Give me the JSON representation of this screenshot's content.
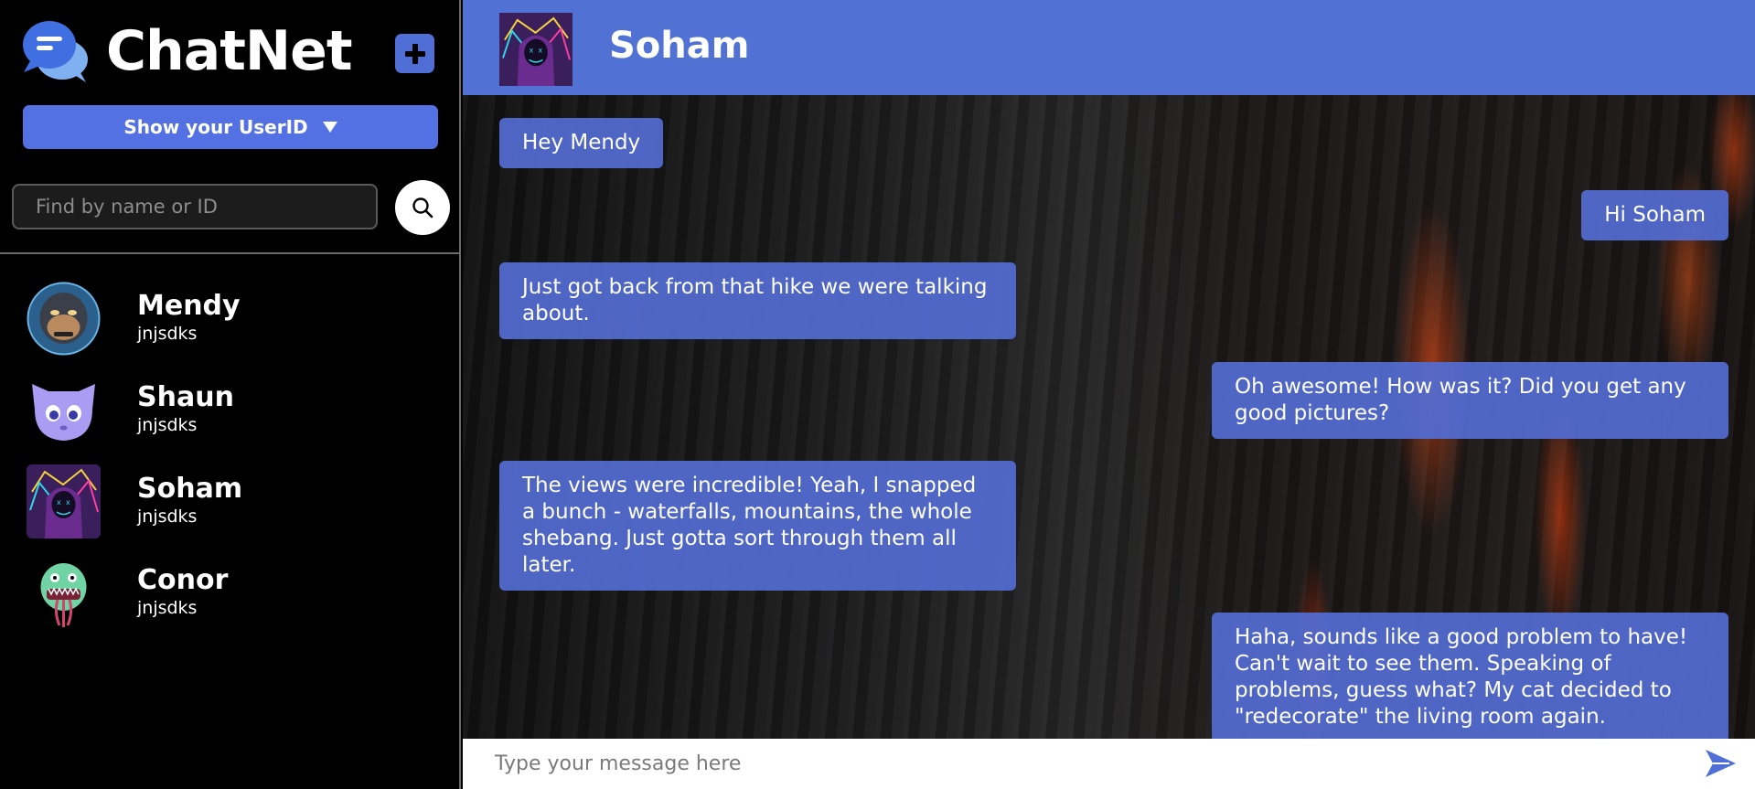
{
  "brand": {
    "title": "ChatNet"
  },
  "sidebar": {
    "userid_button": "Show your UserID",
    "search": {
      "placeholder": "Find by name or ID",
      "value": ""
    },
    "contacts": [
      {
        "name": "Mendy",
        "uid": "jnjsdks",
        "avatar": "gorilla-avatar"
      },
      {
        "name": "Shaun",
        "uid": "jnjsdks",
        "avatar": "purple-cat-avatar"
      },
      {
        "name": "Soham",
        "uid": "jnjsdks",
        "avatar": "hooded-figure-avatar"
      },
      {
        "name": "Conor",
        "uid": "jnjsdks",
        "avatar": "green-monster-avatar"
      }
    ]
  },
  "chat": {
    "title": "Soham",
    "messages": [
      {
        "dir": "in",
        "text": "Hey Mendy"
      },
      {
        "dir": "out",
        "text": "Hi Soham"
      },
      {
        "dir": "in",
        "text": "Just got back from that hike we were talking about."
      },
      {
        "dir": "out",
        "text": "Oh awesome! How was it? Did you get any good pictures?"
      },
      {
        "dir": "in",
        "text": "The views were incredible! Yeah, I snapped a bunch - waterfalls, mountains, the whole shebang. Just gotta sort through them all later."
      },
      {
        "dir": "out",
        "text": "Haha, sounds like a good problem to have! Can't wait to see them. Speaking of problems, guess what? My cat decided to \"redecorate\" the living room again."
      }
    ],
    "composer": {
      "placeholder": "Type your message here",
      "value": ""
    }
  },
  "colors": {
    "accent": "#5471e3",
    "header": "#5271d4",
    "bubble": "#536cd2",
    "sidebar_bg": "#000000"
  }
}
